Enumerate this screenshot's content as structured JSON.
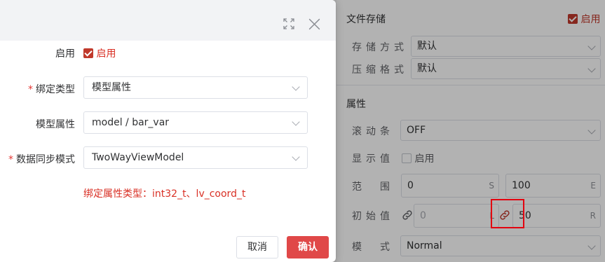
{
  "panel": {
    "file_storage": {
      "title": "文件存储",
      "enable_label": "启用",
      "enable_checked": true,
      "storage_label": "存储方式",
      "storage_value": "默认",
      "compress_label": "压缩格式",
      "compress_value": "默认"
    },
    "props": {
      "title": "属性",
      "scroll_label": "滚动条",
      "scroll_value": "OFF",
      "show_value_label": "显示值",
      "show_value_check": "启用",
      "show_value_checked": false,
      "range_label": "范围",
      "range_min": "0",
      "range_min_suffix": "S",
      "range_max": "100",
      "range_max_suffix": "E",
      "init_label": "初始值",
      "init_left": "0",
      "init_left_suffix": "L",
      "init_right": "50",
      "init_right_suffix": "R",
      "mode_label": "模式",
      "mode_value": "Normal"
    }
  },
  "dialog": {
    "enable_label": "启用",
    "enable_check": "启用",
    "enable_checked": true,
    "bind_type_label": "绑定类型",
    "bind_type_value": "模型属性",
    "model_attr_label": "模型属性",
    "model_attr_value": "model / bar_var",
    "sync_mode_label": "数据同步模式",
    "sync_mode_value": "TwoWayViewModel",
    "required_mark": "*",
    "hint": "绑定属性类型：int32_t、lv_coord_t",
    "cancel": "取消",
    "confirm": "确认"
  },
  "colors": {
    "accent": "#e04848",
    "required": "#e53935",
    "highlight": "#e3000f"
  }
}
